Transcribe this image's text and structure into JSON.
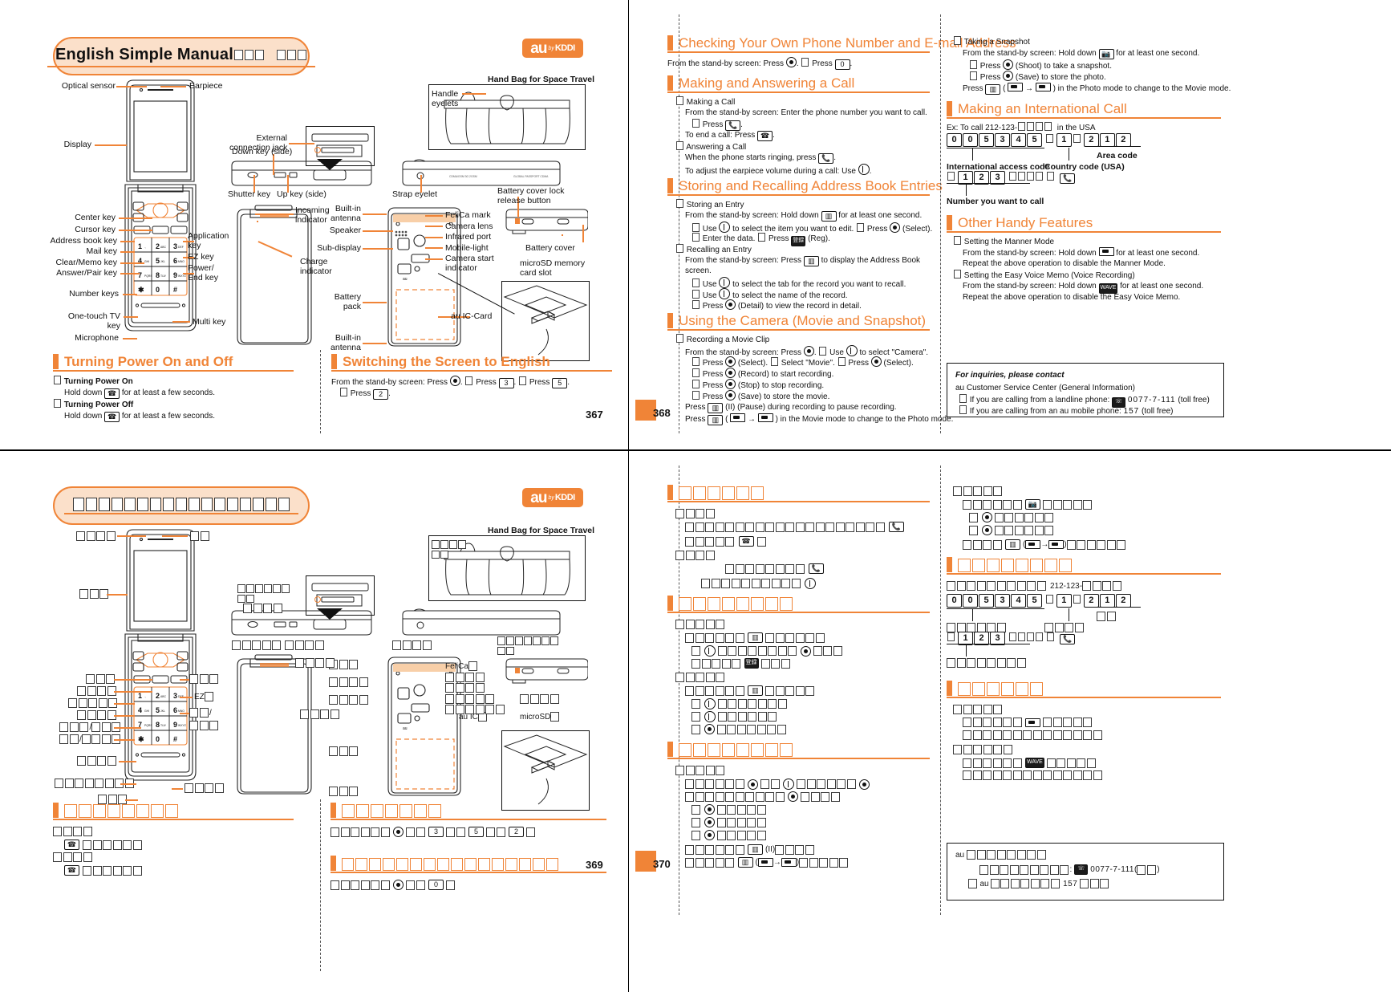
{
  "document": {
    "kind": "au by KDDI English Simple Manual — printed spread",
    "brand": {
      "au": "au",
      "by": "by",
      "kddi": "KDDI"
    }
  },
  "page_367": {
    "page_number": "367",
    "title": "English Simple Manual",
    "title_tofu_count": 6,
    "diagram_labels": {
      "optical_sensor": "Optical sensor",
      "earpiece": "Earpiece",
      "display": "Display",
      "center_key": "Center key",
      "cursor_key": "Cursor key",
      "address_book_key": "Address book key",
      "mail_key": "Mail key",
      "clear_memo_key": "Clear/Memo key",
      "answer_pair_key": "Answer/Pair key",
      "number_keys": "Number keys",
      "one_touch_tv_key": "One-touch TV key",
      "microphone": "Microphone",
      "application_key": "Application key",
      "ez_key": "EZ key",
      "power_end_key": "Power/ End key",
      "multi_key": "Multi key",
      "external_connection_jack": "External connection jack",
      "down_key_side": "Down key (side)",
      "shutter_key": "Shutter key",
      "up_key_side": "Up key (side)",
      "strap_eyelet": "Strap eyelet",
      "incoming_indicator": "Incoming indicator",
      "built_in_antenna": "Built-in antenna",
      "speaker": "Speaker",
      "sub_display": "Sub-display",
      "charge_indicator": "Charge indicator",
      "battery_pack": "Battery pack",
      "felica_mark": "FeliCa mark",
      "camera_lens": "Camera lens",
      "infrared_port": "Infrared port",
      "mobile_light": "Mobile-light",
      "camera_start_indicator": "Camera start indicator",
      "battery_cover_lock_release_button": "Battery cover lock release button",
      "battery_cover": "Battery cover",
      "microsd_memory_card_slot": "microSD memory card slot",
      "au_ic_card": "au IC-Card",
      "hand_bag": "Hand Bag for Space Travel",
      "handle_eyelets": "Handle eyelets",
      "phone_label_left": "CDMA/GSM",
      "phone_label_right": "GLOBAL PASSPORT CDMA"
    },
    "sections": [
      {
        "heading": "Turning Power On and Off",
        "items": [
          {
            "title": "Turning Power On",
            "body_pre": "Hold down",
            "key": "power-end-key",
            "body_post": "for at least a few seconds."
          },
          {
            "title": "Turning Power Off",
            "body_pre": "Hold down",
            "key": "power-end-key",
            "body_post": "for at least a few seconds."
          }
        ]
      }
    ]
  },
  "page_368": {
    "page_number": "368",
    "switching_section": {
      "heading": "Switching the Screen to English",
      "line1_a": "From the stand-by screen: Press",
      "line1_key1": "center-key",
      "line1_b": ". ",
      "line1_c": "Press",
      "line1_key2": "3",
      "line1_d": ". ",
      "line1_e": "Press",
      "line1_key3": "5",
      "line1_f": ".",
      "line2_a": "Press",
      "line2_key": "2",
      "line2_b": "."
    },
    "phone_number_section": {
      "heading": "Checking Your Own Phone Number and E-mail Address",
      "line": "From the stand-by screen: Press",
      "key1": "center-key",
      "mid": ". ",
      "line2": "Press",
      "key2": "0",
      "end": "."
    },
    "call_section": {
      "heading": "Making and Answering a Call",
      "items": [
        {
          "title": "Making a Call",
          "lines": [
            "From the stand-by screen: Enter the phone number you want to call.",
            "Press [call-key].",
            "To end a call: Press [power-end-key]."
          ]
        },
        {
          "title": "Answering a Call",
          "lines": [
            "When the phone starts ringing, press [call-key].",
            "To adjust the earpiece volume during a call: Use [cursor-key]."
          ]
        }
      ]
    },
    "address_section": {
      "heading": "Storing and Recalling Address Book Entries",
      "items": [
        {
          "title": "Storing an Entry",
          "lines": [
            "From the stand-by screen: Hold down [address-book-key] for at least one second.",
            "Use [cursor-key] to select the item you want to edit. [arrow] Press [center-key] (Select).",
            "Enter the data. [arrow] Press [reg-key] (Reg)."
          ]
        },
        {
          "title": "Recalling an Entry",
          "lines": [
            "From the stand-by screen: Press [address-book-key] to display the Address Book screen.",
            "Use [cursor-lr] to select the tab for the record you want to recall.",
            "Use [cursor-key] to select the name of the record.",
            "Press [center-key] (Detail) to view the record in detail."
          ]
        }
      ]
    },
    "camera_section": {
      "heading": "Using the Camera (Movie and Snapshot)",
      "items": [
        {
          "title": "Recording a Movie Clip",
          "lines": [
            "From the stand-by screen: Press [center-key]. [arrow] Use [multi-cursor] to select \"Camera\".",
            "Press [center-key] (Select). [arrow] Select \"Movie\". [arrow] Press [center-key] (Select).",
            "Press [center-key] (Record) to start recording.",
            "Press [center-key] (Stop) to stop recording.",
            "Press [center-key] (Save) to store the movie.",
            "Press [address-book-key] (II) (Pause) during recording to pause recording.",
            "Press [address-book-key] ( [camera] → [movie] ) in the Movie mode to change to the Photo mode."
          ]
        },
        {
          "title": "Taking a Snapshot",
          "lines": [
            "From the stand-by screen: Hold down [camera-key] for at least one second.",
            "Press [center-key] (Shoot) to take a snapshot.",
            "Press [center-key] (Save) to store the photo.",
            "Press [address-book-key] ( [camera] → [movie] ) in the Photo mode to change to the Movie mode."
          ]
        }
      ]
    },
    "international_section": {
      "heading": "Making an International Call",
      "example_prefix": "Ex: To call 212-123-",
      "example_tofu": 4,
      "example_suffix": "in the USA",
      "access_digits": [
        "0",
        "0",
        "5",
        "3",
        "4",
        "5"
      ],
      "country_digits": [
        "1"
      ],
      "area_digits": [
        "2",
        "1",
        "2"
      ],
      "number_digits": [
        "1",
        "2",
        "3"
      ],
      "label_access": "International access code",
      "label_country": "Country code (USA)",
      "label_area": "Area code",
      "label_number": "Number you want to call"
    },
    "handy_section": {
      "heading": "Other Handy Features",
      "items": [
        {
          "title": "Setting the Manner Mode",
          "lines": [
            "From the stand-by screen: Hold down [side-key] for at least one second.",
            "Repeat the above operation to disable the Manner Mode."
          ]
        },
        {
          "title": "Setting the Easy Voice Memo (Voice Recording)",
          "lines": [
            "From the stand-by screen: Hold down [wave-key] for at least one second.",
            "Repeat the above operation to disable the Easy Voice Memo."
          ]
        }
      ]
    },
    "inquiry_box": {
      "title": "For inquiries, please contact",
      "line1": "au Customer Service Center (General Information)",
      "line2_pre": "If you are calling from a landline phone:",
      "line2_number": "0077-7-111",
      "line2_post": "(toll free)",
      "line3_pre": "If you are calling from an au mobile phone:",
      "line3_number": "157",
      "line3_post": "(toll free)"
    }
  },
  "page_369": {
    "page_number": "369",
    "note": "Japanese-language mirror of page 367; CJK glyphs render as missing-glyph boxes in the scan.",
    "title_tofu_count": 17,
    "diagram_label_tofu": [
      2,
      2,
      2,
      2,
      4,
      3,
      3,
      5,
      5,
      6,
      5,
      3,
      4,
      4,
      2,
      4,
      5,
      5,
      3,
      5,
      4,
      4,
      4,
      4,
      5,
      4
    ],
    "section_heading_tofu": 8,
    "bottom_right_heading_tofu": 16
  },
  "page_370": {
    "page_number": "370",
    "note": "Japanese-language mirror of page 368; CJK glyphs render as missing-glyph boxes in the scan.",
    "international_example_number": "212-123-",
    "access_digits": [
      "0",
      "0",
      "5",
      "3",
      "4",
      "5"
    ],
    "country_digits": [
      "1"
    ],
    "area_digits": [
      "2",
      "1",
      "2"
    ],
    "number_digits": [
      "1",
      "2",
      "3"
    ],
    "inquiry_box": {
      "au_prefix": "au",
      "landline_number": "0077-7-111",
      "mobile_number": "157"
    }
  },
  "colors": {
    "accent": "#F08437",
    "accent_fill": "#FBE0CA",
    "text": "#111111",
    "rule": "#000000"
  }
}
